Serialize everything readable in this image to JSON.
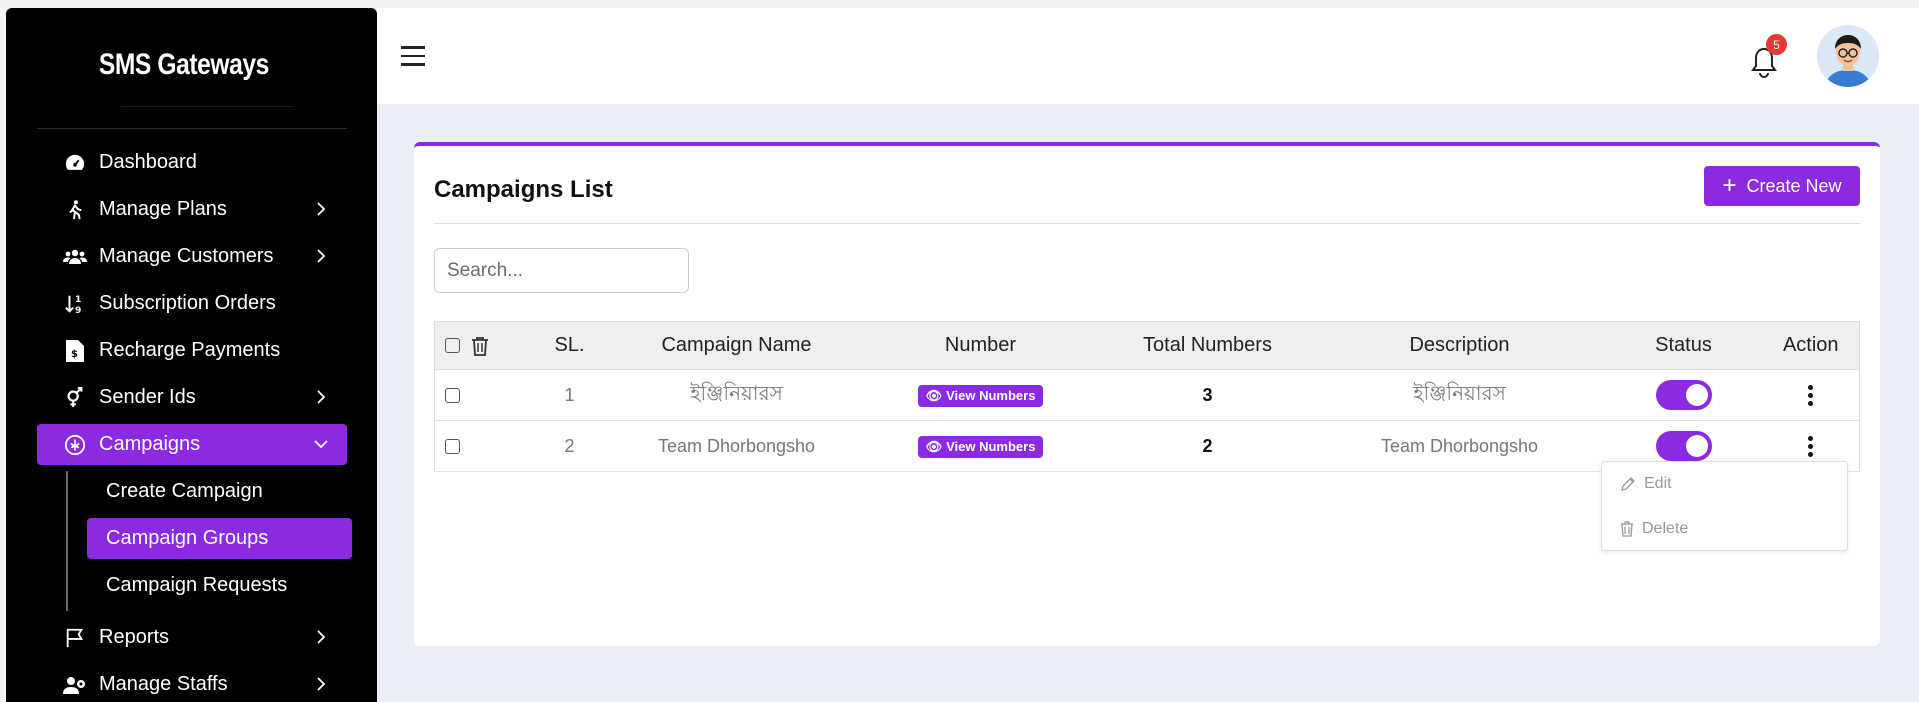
{
  "sidebar": {
    "brand": "SMS Gateways",
    "items": [
      {
        "label": "Dashboard",
        "icon": "gauge-icon"
      },
      {
        "label": "Manage Plans",
        "icon": "walking-icon"
      },
      {
        "label": "Manage Customers",
        "icon": "users-icon"
      },
      {
        "label": "Subscription Orders",
        "icon": "sort-icon"
      },
      {
        "label": "Recharge Payments",
        "icon": "invoice-icon"
      },
      {
        "label": "Sender Ids",
        "icon": "gender-icon"
      },
      {
        "label": "Campaigns",
        "icon": "campaign-icon"
      }
    ],
    "campaign_sub": [
      "Create Campaign",
      "Campaign Groups",
      "Campaign Requests"
    ],
    "items_after": [
      {
        "label": "Reports",
        "icon": "flag-icon"
      },
      {
        "label": "Manage Staffs",
        "icon": "staff-icon"
      }
    ]
  },
  "topbar": {
    "notification_count": "5"
  },
  "main": {
    "title": "Campaigns List",
    "create_label": "Create New",
    "search_placeholder": "Search...",
    "columns": [
      "SL.",
      "Campaign Name",
      "Number",
      "Total Numbers",
      "Description",
      "Status",
      "Action"
    ],
    "rows": [
      {
        "sl": "1",
        "name": "ইঞ্জিনিয়ারস",
        "number_btn": "View Numbers",
        "total": "3",
        "description": "ইঞ্জিনিয়ারস",
        "status_on": true
      },
      {
        "sl": "2",
        "name": "Team Dhorbongsho",
        "number_btn": "View Numbers",
        "total": "2",
        "description": "Team Dhorbongsho",
        "status_on": true
      }
    ],
    "dropdown": {
      "edit": "Edit",
      "delete": "Delete"
    }
  },
  "colors": {
    "accent": "#8a2be2",
    "sidebar_bg": "#000000",
    "badge": "#e53935"
  }
}
